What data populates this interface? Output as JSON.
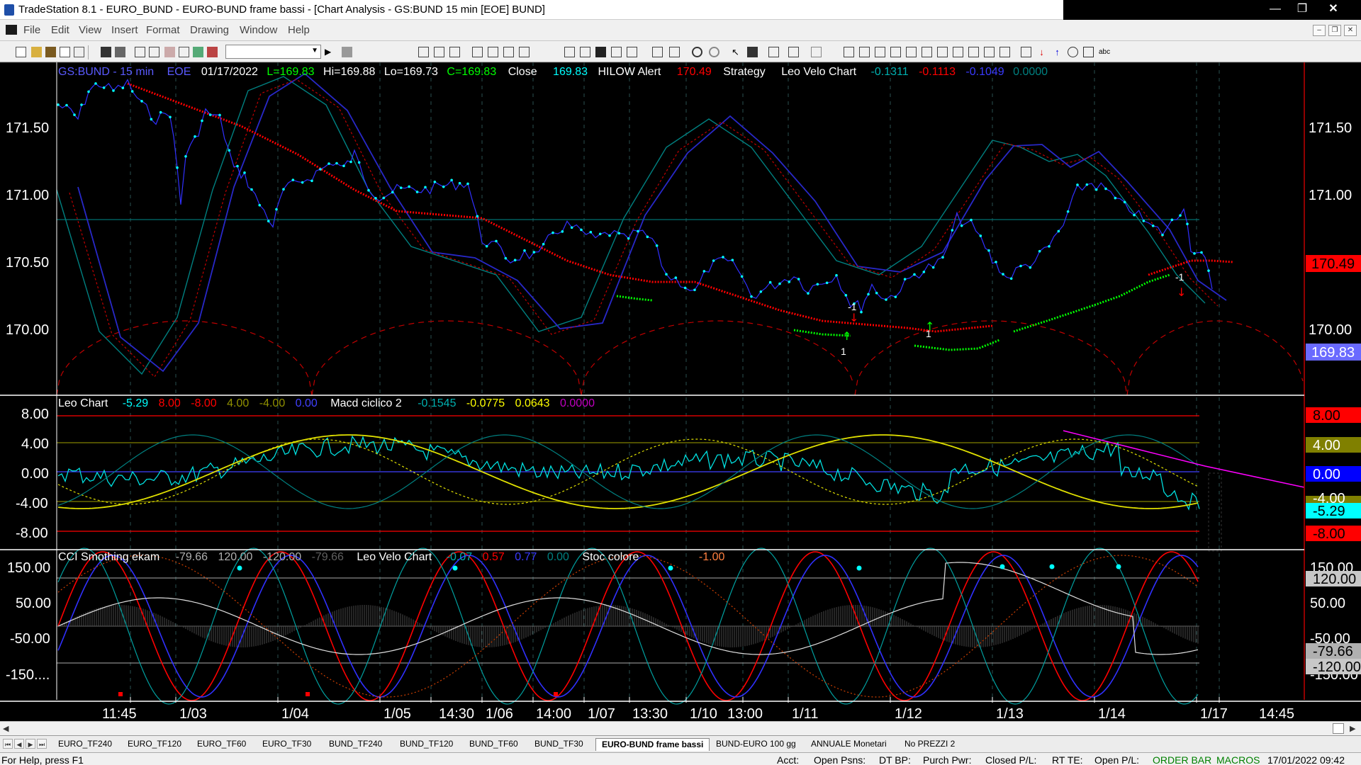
{
  "window": {
    "title": "TradeStation 8.1 - EURO_BUND - EURO-BUND frame bassi - [Chart Analysis - GS:BUND  15 min  [EOE] BUND]"
  },
  "menu": [
    "File",
    "Edit",
    "View",
    "Insert",
    "Format",
    "Drawing",
    "Window",
    "Help"
  ],
  "price_header": {
    "symbol": "GS:BUND - 15 min",
    "exchange": "EOE",
    "date": "01/17/2022",
    "last": "L=169.83",
    "hi": "Hi=169.88",
    "lo": "Lo=169.73",
    "close": "C=169.83",
    "close_label": "Close",
    "close_val": "169.83",
    "hilow_label": "HILOW Alert",
    "hilow_val": "170.49",
    "strategy": "Strategy",
    "velo_label": "Leo Velo Chart",
    "velo_v1": "-0.1311",
    "velo_v2": "-0.1113",
    "velo_v3": "-0.1049",
    "velo_v4": "0.0000"
  },
  "osc_header": {
    "leo_label": "Leo Chart",
    "leo_v1": "-5.29",
    "leo_v2": "8.00",
    "leo_v3": "-8.00",
    "leo_v4": "4.00",
    "leo_v5": "-4.00",
    "leo_v6": "0.00",
    "macd_label": "Macd ciclico 2",
    "macd_v1": "-0.1545",
    "macd_v2": "-0.0775",
    "macd_v3": "0.0643",
    "macd_v4": "0.0000"
  },
  "cci_header": {
    "cci_label": "CCI Smothing ekam",
    "cci_v1": "-79.66",
    "cci_v2": "120.00",
    "cci_v3": "-120.00",
    "cci_v4": "-79.66",
    "velo_label": "Leo Velo Chart",
    "velo_v1": "-0.07",
    "velo_v2": "0.57",
    "velo_v3": "0.77",
    "velo_v4": "0.00",
    "stoc_label": "Stoc colore",
    "stoc_v1": "-1.00"
  },
  "price_axis": [
    "171.50",
    "171.00",
    "170.50",
    "170.00"
  ],
  "osc_axis": [
    "8.00",
    "4.00",
    "0.00",
    "-4.00",
    "-8.00"
  ],
  "cci_axis": [
    "150.00",
    "50.00",
    "-50.00",
    "-150...."
  ],
  "cci_axis_right": [
    "150.00",
    "50.00",
    "-50.00",
    "-150.00"
  ],
  "price_boxes": {
    "hilow": "170.49",
    "last": "169.83"
  },
  "osc_boxes": {
    "b8": "8.00",
    "b4": "4.00",
    "b0": "0.00",
    "bm4": "-4.00",
    "cur": "-5.29",
    "bm8": "-8.00"
  },
  "cci_boxes": {
    "b120": "120.00",
    "cur": "-79.66",
    "bm120": "-120.00"
  },
  "marks": {
    "m1": "-1",
    "m2": "1",
    "m3": "1",
    "m4": "-1"
  },
  "time_axis": [
    "11:45",
    "1/03",
    "1/04",
    "1/05",
    "14:30",
    "1/06",
    "14:00",
    "1/07",
    "13:30",
    "1/10",
    "13:00",
    "1/11",
    "1/12",
    "1/13",
    "1/14",
    "1/17",
    "14:45"
  ],
  "tabs": [
    "EURO_TF240",
    "EURO_TF120",
    "EURO_TF60",
    "EURO_TF30",
    "BUND_TF240",
    "BUND_TF120",
    "BUND_TF60",
    "BUND_TF30",
    "EURO-BUND frame bassi",
    "BUND-EURO 100 gg",
    "ANNUALE Monetari",
    "No PREZZI 2"
  ],
  "status": {
    "help": "For Help, press F1",
    "acct": "Acct:",
    "open_psns": "Open Psns:",
    "dt_bp": "DT BP:",
    "purch": "Purch Pwr:",
    "closed": "Closed P/L:",
    "rt_te": "RT TE:",
    "open_pl": "Open P/L:",
    "order_bar": "ORDER BAR",
    "macros": "MACROS",
    "datetime": "17/01/2022 09:42"
  },
  "colors": {
    "cyan": "#00ffff",
    "red": "#ff0000",
    "green": "#00ff00",
    "navy": "#2020c0",
    "teal": "#008080",
    "yellow": "#ffff00",
    "magenta": "#ff00ff"
  }
}
